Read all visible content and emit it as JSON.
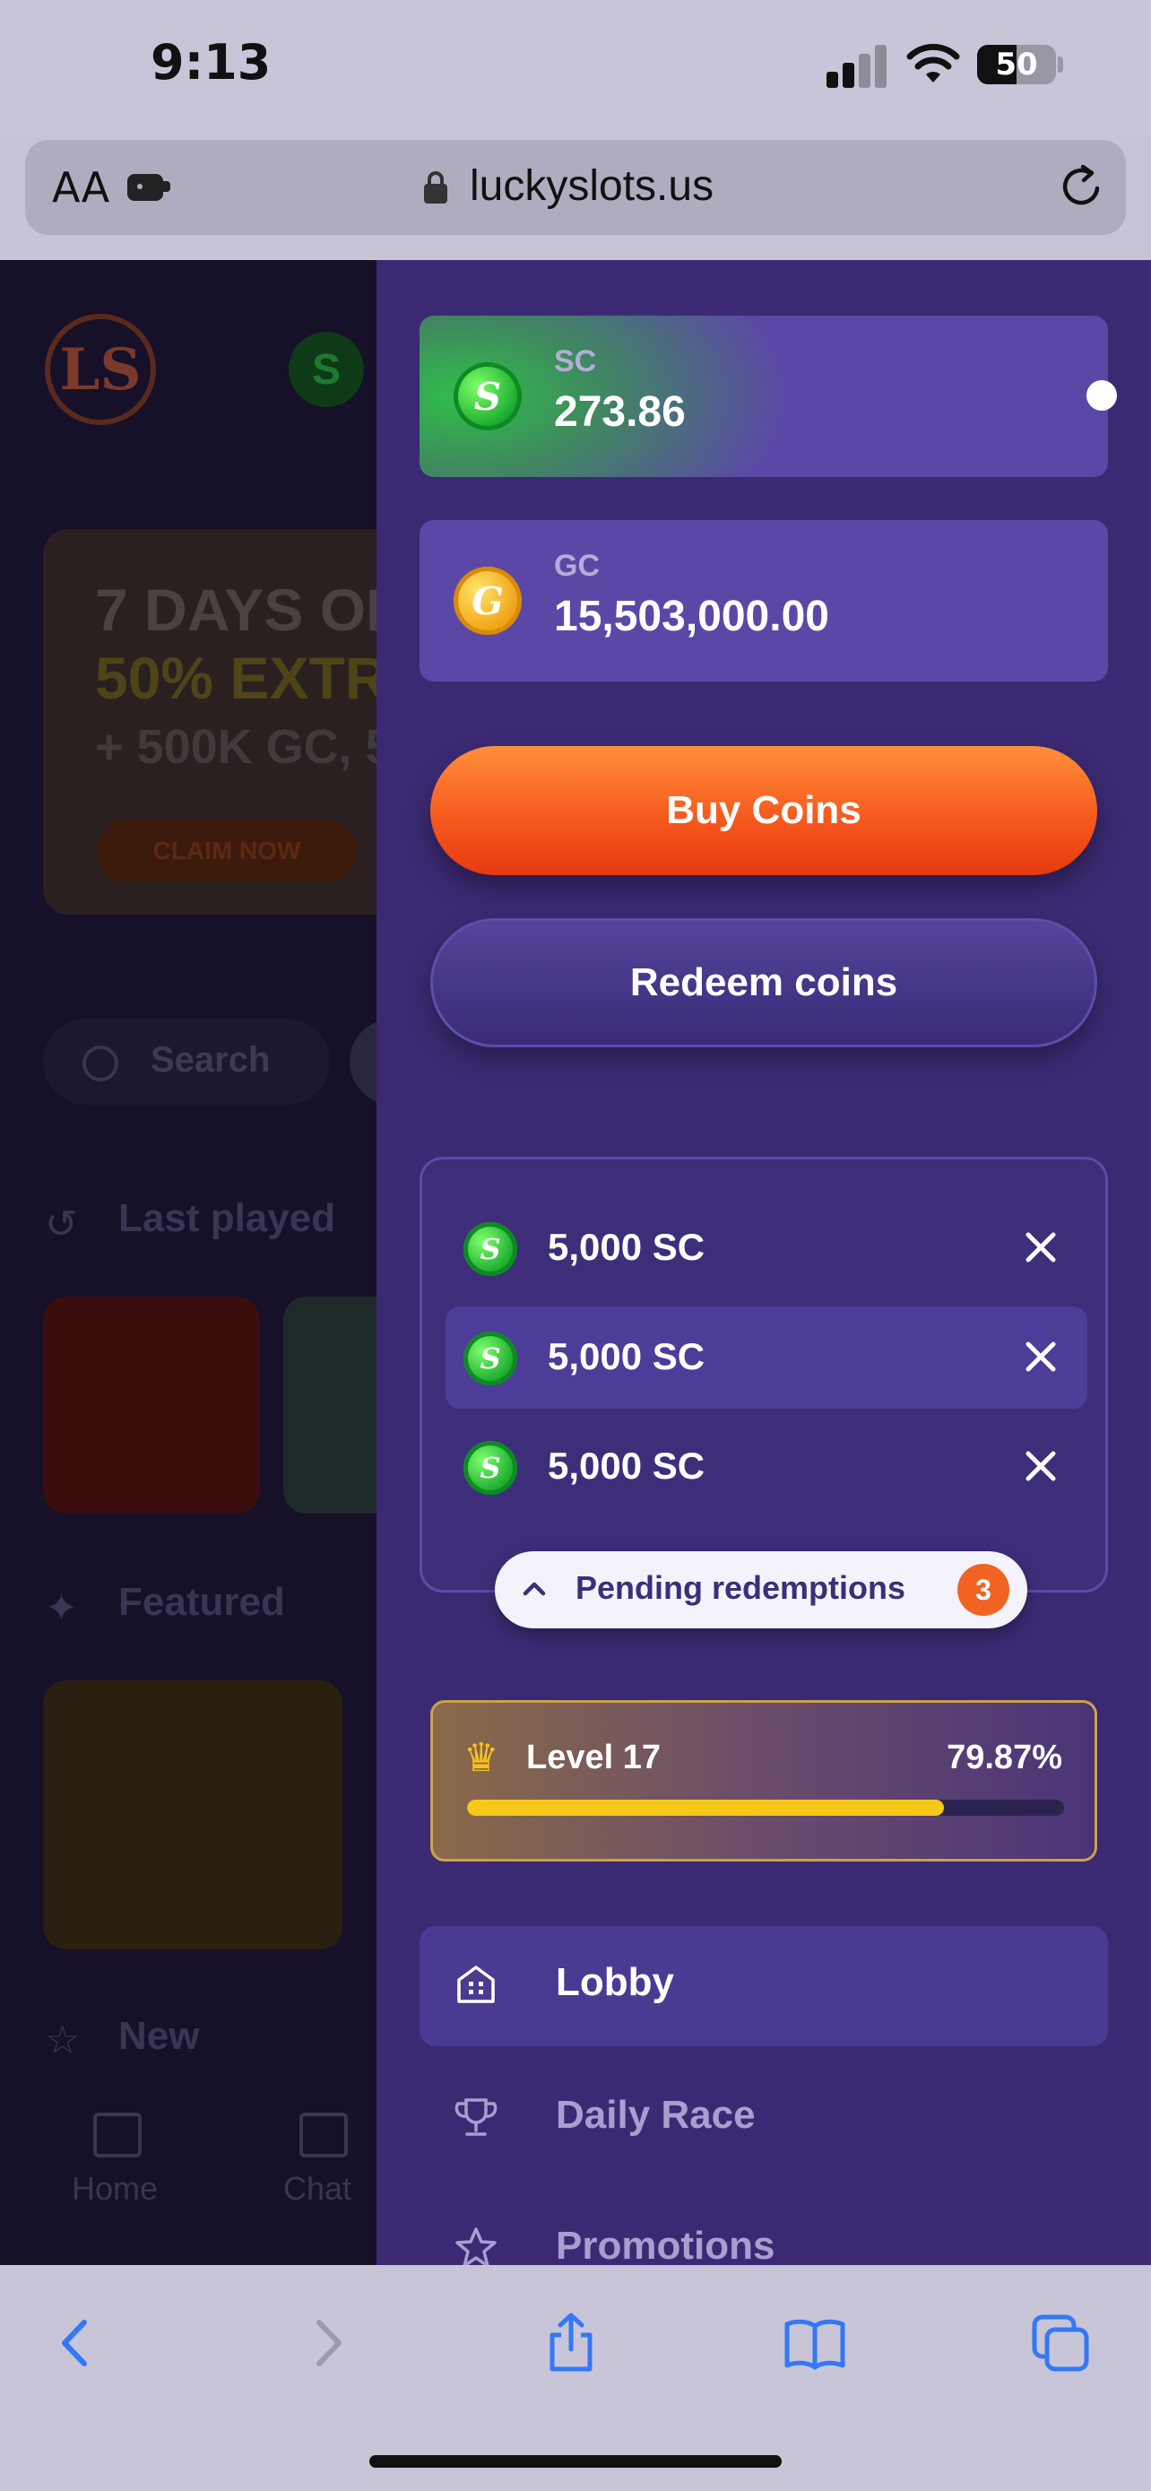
{
  "status_bar": {
    "time": "9:13",
    "battery": "50"
  },
  "browser": {
    "text_size_label": "AA",
    "url": "luckyslots.us"
  },
  "background_app": {
    "logo_text": "LS",
    "promo": {
      "line1": "7 DAYS OF",
      "line2": "50% EXTRA",
      "line3": "+ 500K GC, 5",
      "button": "CLAIM NOW"
    },
    "search_placeholder": "Search",
    "sections": {
      "last_played": "Last played",
      "featured": "Featured",
      "new": "New"
    },
    "nav": {
      "home": "Home",
      "chat": "Chat"
    }
  },
  "drawer": {
    "balances": [
      {
        "label": "SC",
        "value": "273.86",
        "coin": "S"
      },
      {
        "label": "GC",
        "value": "15,503,000.00",
        "coin": "G"
      }
    ],
    "buy_button": "Buy Coins",
    "redeem_button": "Redeem coins",
    "pending": {
      "items": [
        {
          "amount": "5,000 SC"
        },
        {
          "amount": "5,000 SC"
        },
        {
          "amount": "5,000 SC"
        }
      ],
      "label": "Pending redemptions",
      "count": "3"
    },
    "level": {
      "label": "Level 17",
      "percent": "79.87%",
      "progress": 0.7987
    },
    "menu": [
      {
        "label": "Lobby",
        "icon": "lobby-icon",
        "active": true
      },
      {
        "label": "Daily Race",
        "icon": "trophy-icon",
        "active": false
      },
      {
        "label": "Promotions",
        "icon": "star-icon",
        "active": false
      }
    ]
  },
  "colors": {
    "drawer_bg": "#3b2a73",
    "buy_orange": "#f5561c",
    "level_fill": "#f6c81a",
    "badge_orange": "#f26322",
    "ios_blue": "#3478f6"
  }
}
